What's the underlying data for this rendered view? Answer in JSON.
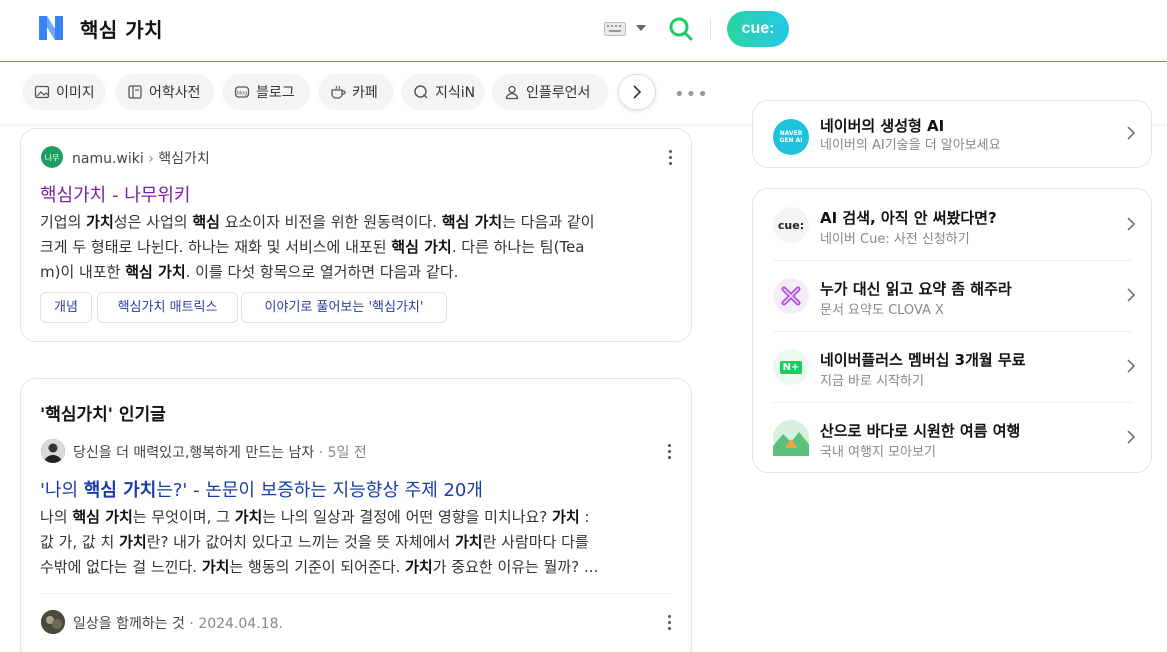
{
  "header": {
    "query": "핵심 가치",
    "cue_label": "cue:"
  },
  "tabs": [
    {
      "label": "이미지",
      "icon": "image-icon"
    },
    {
      "label": "어학사전",
      "icon": "dictionary-icon"
    },
    {
      "label": "블로그",
      "icon": "blog-icon"
    },
    {
      "label": "카페",
      "icon": "cafe-icon"
    },
    {
      "label": "지식iN",
      "icon": "kin-icon"
    },
    {
      "label": "인플루언서",
      "icon": "influencer-icon"
    }
  ],
  "result1": {
    "source": "namu.wiki",
    "breadcrumb": "핵심가치",
    "title_main": "핵심가치",
    "title_suffix": "- 나무위키",
    "snippet": {
      "p1": "기업의 ",
      "b1": "가치",
      "p2": "성은 사업의 ",
      "b2": "핵심",
      "p3": " 요소이자 비전을 위한 원동력이다. ",
      "b3": "핵심 가치",
      "p4": "는 다음과 같이",
      "p5": "크게 두 형태로 나뉜다. 하나는 재화 및 서비스에 내포된 ",
      "b4": "핵심 가치",
      "p6": ". 다른 하나는 팀(Tea",
      "p7": "m)이 내포한 ",
      "b5": "핵심 가치",
      "p8": ". 이를 다섯 항목으로 열거하면 다음과 같다."
    },
    "chips": [
      "개념",
      "핵심가치 매트릭스",
      "이야기로 풀어보는 '핵심가치'"
    ]
  },
  "popular": {
    "section_title": "'핵심가치' 인기글",
    "post1": {
      "author": "당신을 더 매력있고,행복하게 만드는 남자",
      "time": "5일 전",
      "title_p1": "'나의 ",
      "title_b1": "핵심 가치",
      "title_p2": "는?' - 논문이 보증하는 지능향상 주제 20개",
      "snippet": {
        "p1": "나의 ",
        "b1": "핵심 가치",
        "p2": "는 무엇이며, 그 ",
        "b2": "가치",
        "p3": "는 나의 일상과 결정에 어떤 영향을 미치나요? ",
        "b3": "가치",
        "p4": " :",
        "p5": "값 가, 값 치 ",
        "b4": "가치",
        "p6": "란? 내가 값어치 있다고 느끼는 것을 뜻 자체에서 ",
        "b5": "가치",
        "p7": "란 사람마다 다를",
        "p8": "수밖에 없다는 걸 느낀다. ",
        "b6": "가치",
        "p9": "는 행동의 기준이 되어준다. ",
        "b7": "가치",
        "p10": "가 중요한 이유는 뭘까? ..."
      }
    },
    "post2": {
      "author": "일상을 함께하는 것",
      "time": "2024.04.18."
    }
  },
  "right": {
    "top_item": {
      "title": "네이버의 생성형 AI",
      "sub": "네이버의 AI기술을 더 알아보세요",
      "icon_text": "NAVER GEN AI"
    },
    "items": [
      {
        "title": "AI 검색, 아직 안 써봤다면?",
        "sub": "네이버 Cue: 사전 신청하기",
        "icon": "cue-icon",
        "icon_text": "cue:"
      },
      {
        "title": "누가 대신 읽고 요약 좀 해주라",
        "sub": "문서 요약도 CLOVA X",
        "icon": "clova-x-icon"
      },
      {
        "title": "네이버플러스 멤버십 3개월 무료",
        "sub": "지금 바로 시작하기",
        "icon": "naver-plus-icon",
        "icon_text": "N+"
      },
      {
        "title": "산으로 바다로 시원한 여름 여행",
        "sub": "국내 여행지 모아보기",
        "icon": "camping-icon"
      }
    ]
  },
  "colors": {
    "naver_green": "#19ce60",
    "visited_link": "#7a1fa2",
    "link": "#1a3ca8",
    "chip_text": "#2b3e9b"
  }
}
